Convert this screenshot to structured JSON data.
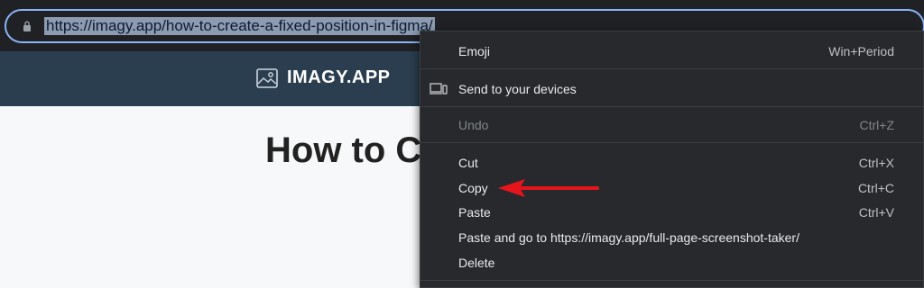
{
  "address_bar": {
    "url": "https://imagy.app/how-to-create-a-fixed-position-in-figma/"
  },
  "site": {
    "logo_text": "IMAGY.APP",
    "page_title": "How to C"
  },
  "context_menu": {
    "items": [
      {
        "label": "Emoji",
        "shortcut": "Win+Period"
      },
      {
        "label": "Send to your devices",
        "icon": "devices-icon"
      },
      {
        "label": "Undo",
        "shortcut": "Ctrl+Z",
        "disabled": true
      },
      {
        "label": "Cut",
        "shortcut": "Ctrl+X"
      },
      {
        "label": "Copy",
        "shortcut": "Ctrl+C"
      },
      {
        "label": "Paste",
        "shortcut": "Ctrl+V"
      },
      {
        "label": "Paste and go to https://imagy.app/full-page-screenshot-taker/"
      },
      {
        "label": "Delete"
      }
    ]
  },
  "annotation": {
    "arrow_color": "#e8141b",
    "points_to": "Copy"
  },
  "colors": {
    "browser_bg": "#202124",
    "header_bg": "#2b3e50",
    "menu_bg": "#28292c",
    "focus_ring": "#8ab4f8"
  }
}
